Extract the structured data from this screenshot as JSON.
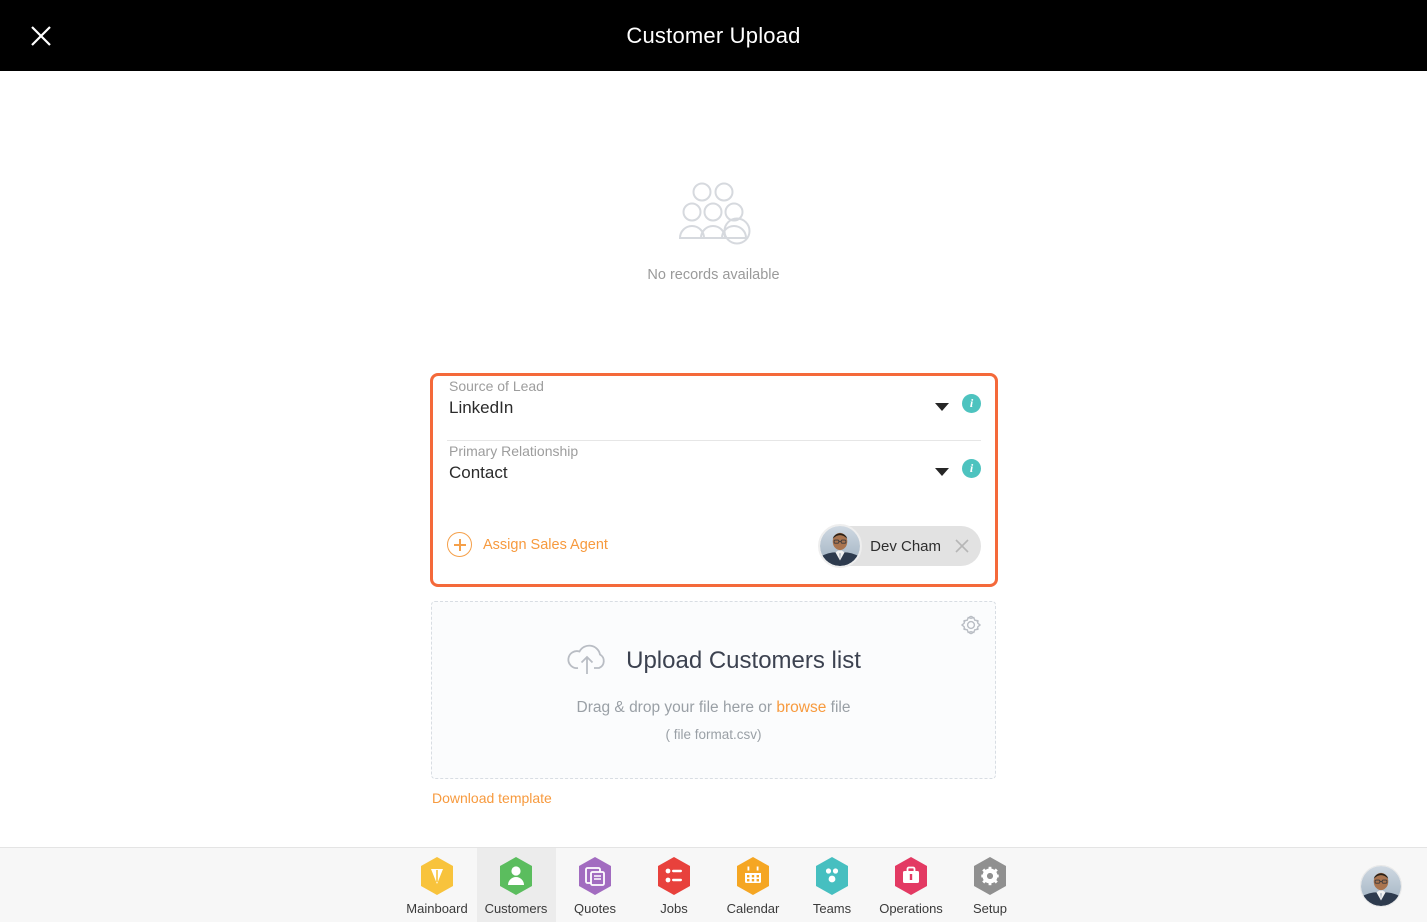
{
  "header": {
    "title": "Customer Upload",
    "close_icon": "close-icon"
  },
  "empty_state": {
    "icon": "people-group-icon",
    "message": "No records available"
  },
  "form": {
    "highlighted": true,
    "highlight_color": "#f4693a",
    "fields": [
      {
        "label": "Source of Lead",
        "value": "LinkedIn",
        "caret_icon": "chevron-down-icon",
        "info_icon": "info-icon",
        "info_color": "#4dc3bf"
      },
      {
        "label": "Primary Relationship",
        "value": "Contact",
        "caret_icon": "chevron-down-icon",
        "info_icon": "info-icon",
        "info_color": "#4dc3bf"
      }
    ],
    "assign_agent": {
      "label": "Assign Sales Agent",
      "icon": "plus-circle-icon",
      "color": "#f79a3e"
    },
    "assigned_agents": [
      {
        "name": "Dev Cham",
        "avatar_icon": "avatar",
        "remove_icon": "close-icon"
      }
    ]
  },
  "dropzone": {
    "settings_icon": "gear-icon",
    "upload_icon": "cloud-upload-icon",
    "title": "Upload Customers list",
    "instruction_prefix": "Drag & drop your file here or ",
    "browse_label": "browse",
    "instruction_suffix": " file",
    "file_format": "( file format.csv)",
    "download_template_label": "Download template",
    "link_color": "#f79a3e"
  },
  "bottom_nav": {
    "active": "Customers",
    "items": [
      {
        "label": "Mainboard",
        "icon": "mainboard-icon",
        "color": "#f8c33c",
        "active": false
      },
      {
        "label": "Customers",
        "icon": "customers-icon",
        "color": "#5bbd5e",
        "active": true
      },
      {
        "label": "Quotes",
        "icon": "quotes-icon",
        "color": "#a26cc0",
        "active": false
      },
      {
        "label": "Jobs",
        "icon": "jobs-icon",
        "color": "#e8413c",
        "active": false
      },
      {
        "label": "Calendar",
        "icon": "calendar-icon",
        "color": "#f5a623",
        "active": false
      },
      {
        "label": "Teams",
        "icon": "teams-icon",
        "color": "#46bfc0",
        "active": false
      },
      {
        "label": "Operations",
        "icon": "operations-icon",
        "color": "#e33a63",
        "active": false
      },
      {
        "label": "Setup",
        "icon": "setup-icon",
        "color": "#909090",
        "active": false
      }
    ],
    "user_avatar_icon": "avatar"
  }
}
